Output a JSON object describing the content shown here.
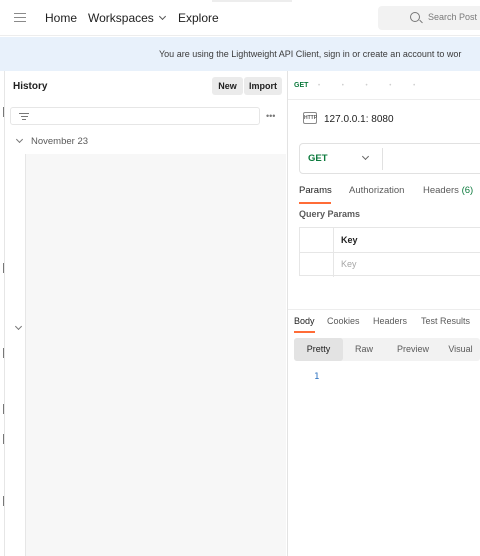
{
  "nav": {
    "items": [
      "Home",
      "Workspaces",
      "Explore"
    ],
    "search_placeholder": "Search Post"
  },
  "banner": {
    "text": "You are using the Lightweight API Client, sign in or create an account to wor"
  },
  "history": {
    "title": "History",
    "new_label": "New",
    "import_label": "Import",
    "more_label": "•••",
    "group_label": "November 23"
  },
  "request": {
    "tab_method": "GET",
    "tab_dots": "• • • • •",
    "name": "127.0.0.1:  8080",
    "http_icon_text": "HTTP",
    "method": "GET",
    "tabs": {
      "params": "Params",
      "authorization": "Authorization",
      "headers": "Headers",
      "headers_count": "(6)"
    },
    "query_params_label": "Query Params",
    "key_header": "Key",
    "key_placeholder": "Key"
  },
  "response": {
    "tabs": [
      "Body",
      "Cookies",
      "Headers",
      "Test Results"
    ],
    "views": [
      "Pretty",
      "Raw",
      "Preview",
      "Visual"
    ],
    "line_number": "1"
  }
}
